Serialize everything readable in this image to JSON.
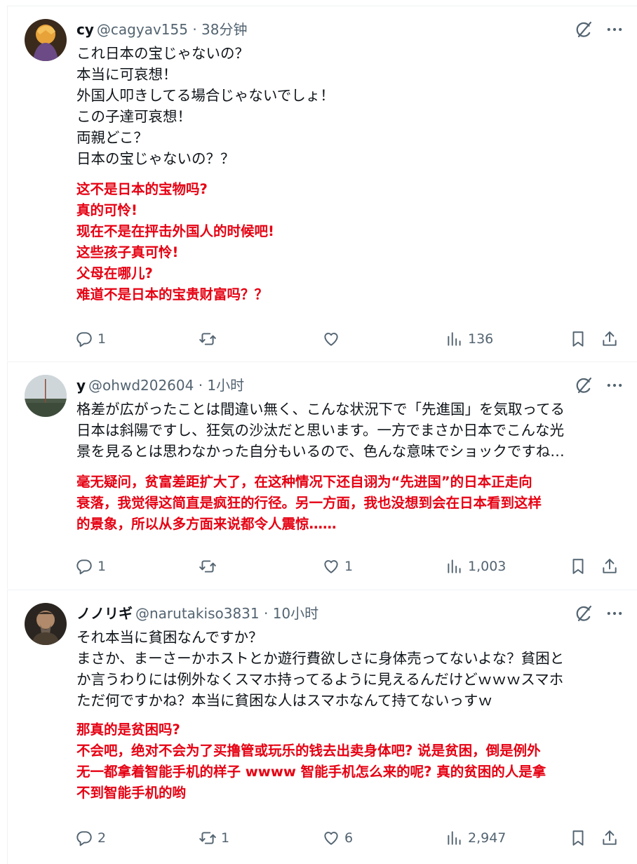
{
  "tweets": [
    {
      "name": "cy",
      "handle": "@cagyav155 · 38分钟",
      "jp_lines": [
        "これ日本の宝じゃないの？",
        "本当に可哀想！",
        "外国人叩きしてる場合じゃないでしょ！",
        "この子達可哀想！",
        "両親どこ？",
        "日本の宝じゃないの？？"
      ],
      "zh_lines": [
        "这不是日本的宝物吗?",
        "真的可怜!",
        "现在不是在抨击外国人的时候吧!",
        "这些孩子真可怜!",
        "父母在哪儿?",
        "难道不是日本的宝贵财富吗？？"
      ],
      "replies": "1",
      "reposts": "",
      "likes": "",
      "views": "136"
    },
    {
      "name": "y",
      "handle": "@ohwd202604 · 1小时",
      "jp_lines": [
        "格差が広がったことは間違い無く、こんな状況下で「先進国」を気取ってる",
        "日本は斜陽ですし、狂気の沙汰だと思います。一方でまさか日本でこんな光",
        "景を見るとは思わなかった自分もいるので、色んな意味でショックですね…"
      ],
      "zh_lines": [
        "毫无疑问，贫富差距扩大了，在这种情况下还自诩为“先进国”的日本正走向",
        "衰落，我觉得这简直是疯狂的行径。另一方面，我也没想到会在日本看到这样",
        "的景象，所以从多方面来说都令人震惊……"
      ],
      "replies": "1",
      "reposts": "",
      "likes": "1",
      "views": "1,003"
    },
    {
      "name": "ノノリギ",
      "handle": "@narutakiso3831 · 10小时",
      "jp_lines": [
        "それ本当に貧困なんですか？",
        "まさか、まーさーかホストとか遊行費欲しさに身体売ってないよな？貧困と",
        "か言うわりには例外なくスマホ持ってるように見えるんだけどｗｗｗスマホ",
        "ただ何ですかね？本当に貧困な人はスマホなんて持てないっすｗ"
      ],
      "zh_lines": [
        "那真的是贫困吗?",
        "不会吧，绝对不会为了买撸管或玩乐的钱去出卖身体吧? 说是贫困，倒是例外",
        "无一都拿着智能手机的样子 wwww 智能手机怎么来的呢? 真的贫困的人是拿",
        "不到智能手机的哟"
      ],
      "replies": "2",
      "reposts": "1",
      "likes": "6",
      "views": "2,947"
    }
  ],
  "icons": {
    "reply": "reply-icon",
    "repost": "repost-icon",
    "like": "like-icon",
    "views": "views-icon",
    "bookmark": "bookmark-icon",
    "share": "share-icon",
    "grok": "grok-icon",
    "more": "more-icon"
  },
  "colors": {
    "translation_red": "#e60012",
    "secondary_gray": "#536471"
  }
}
